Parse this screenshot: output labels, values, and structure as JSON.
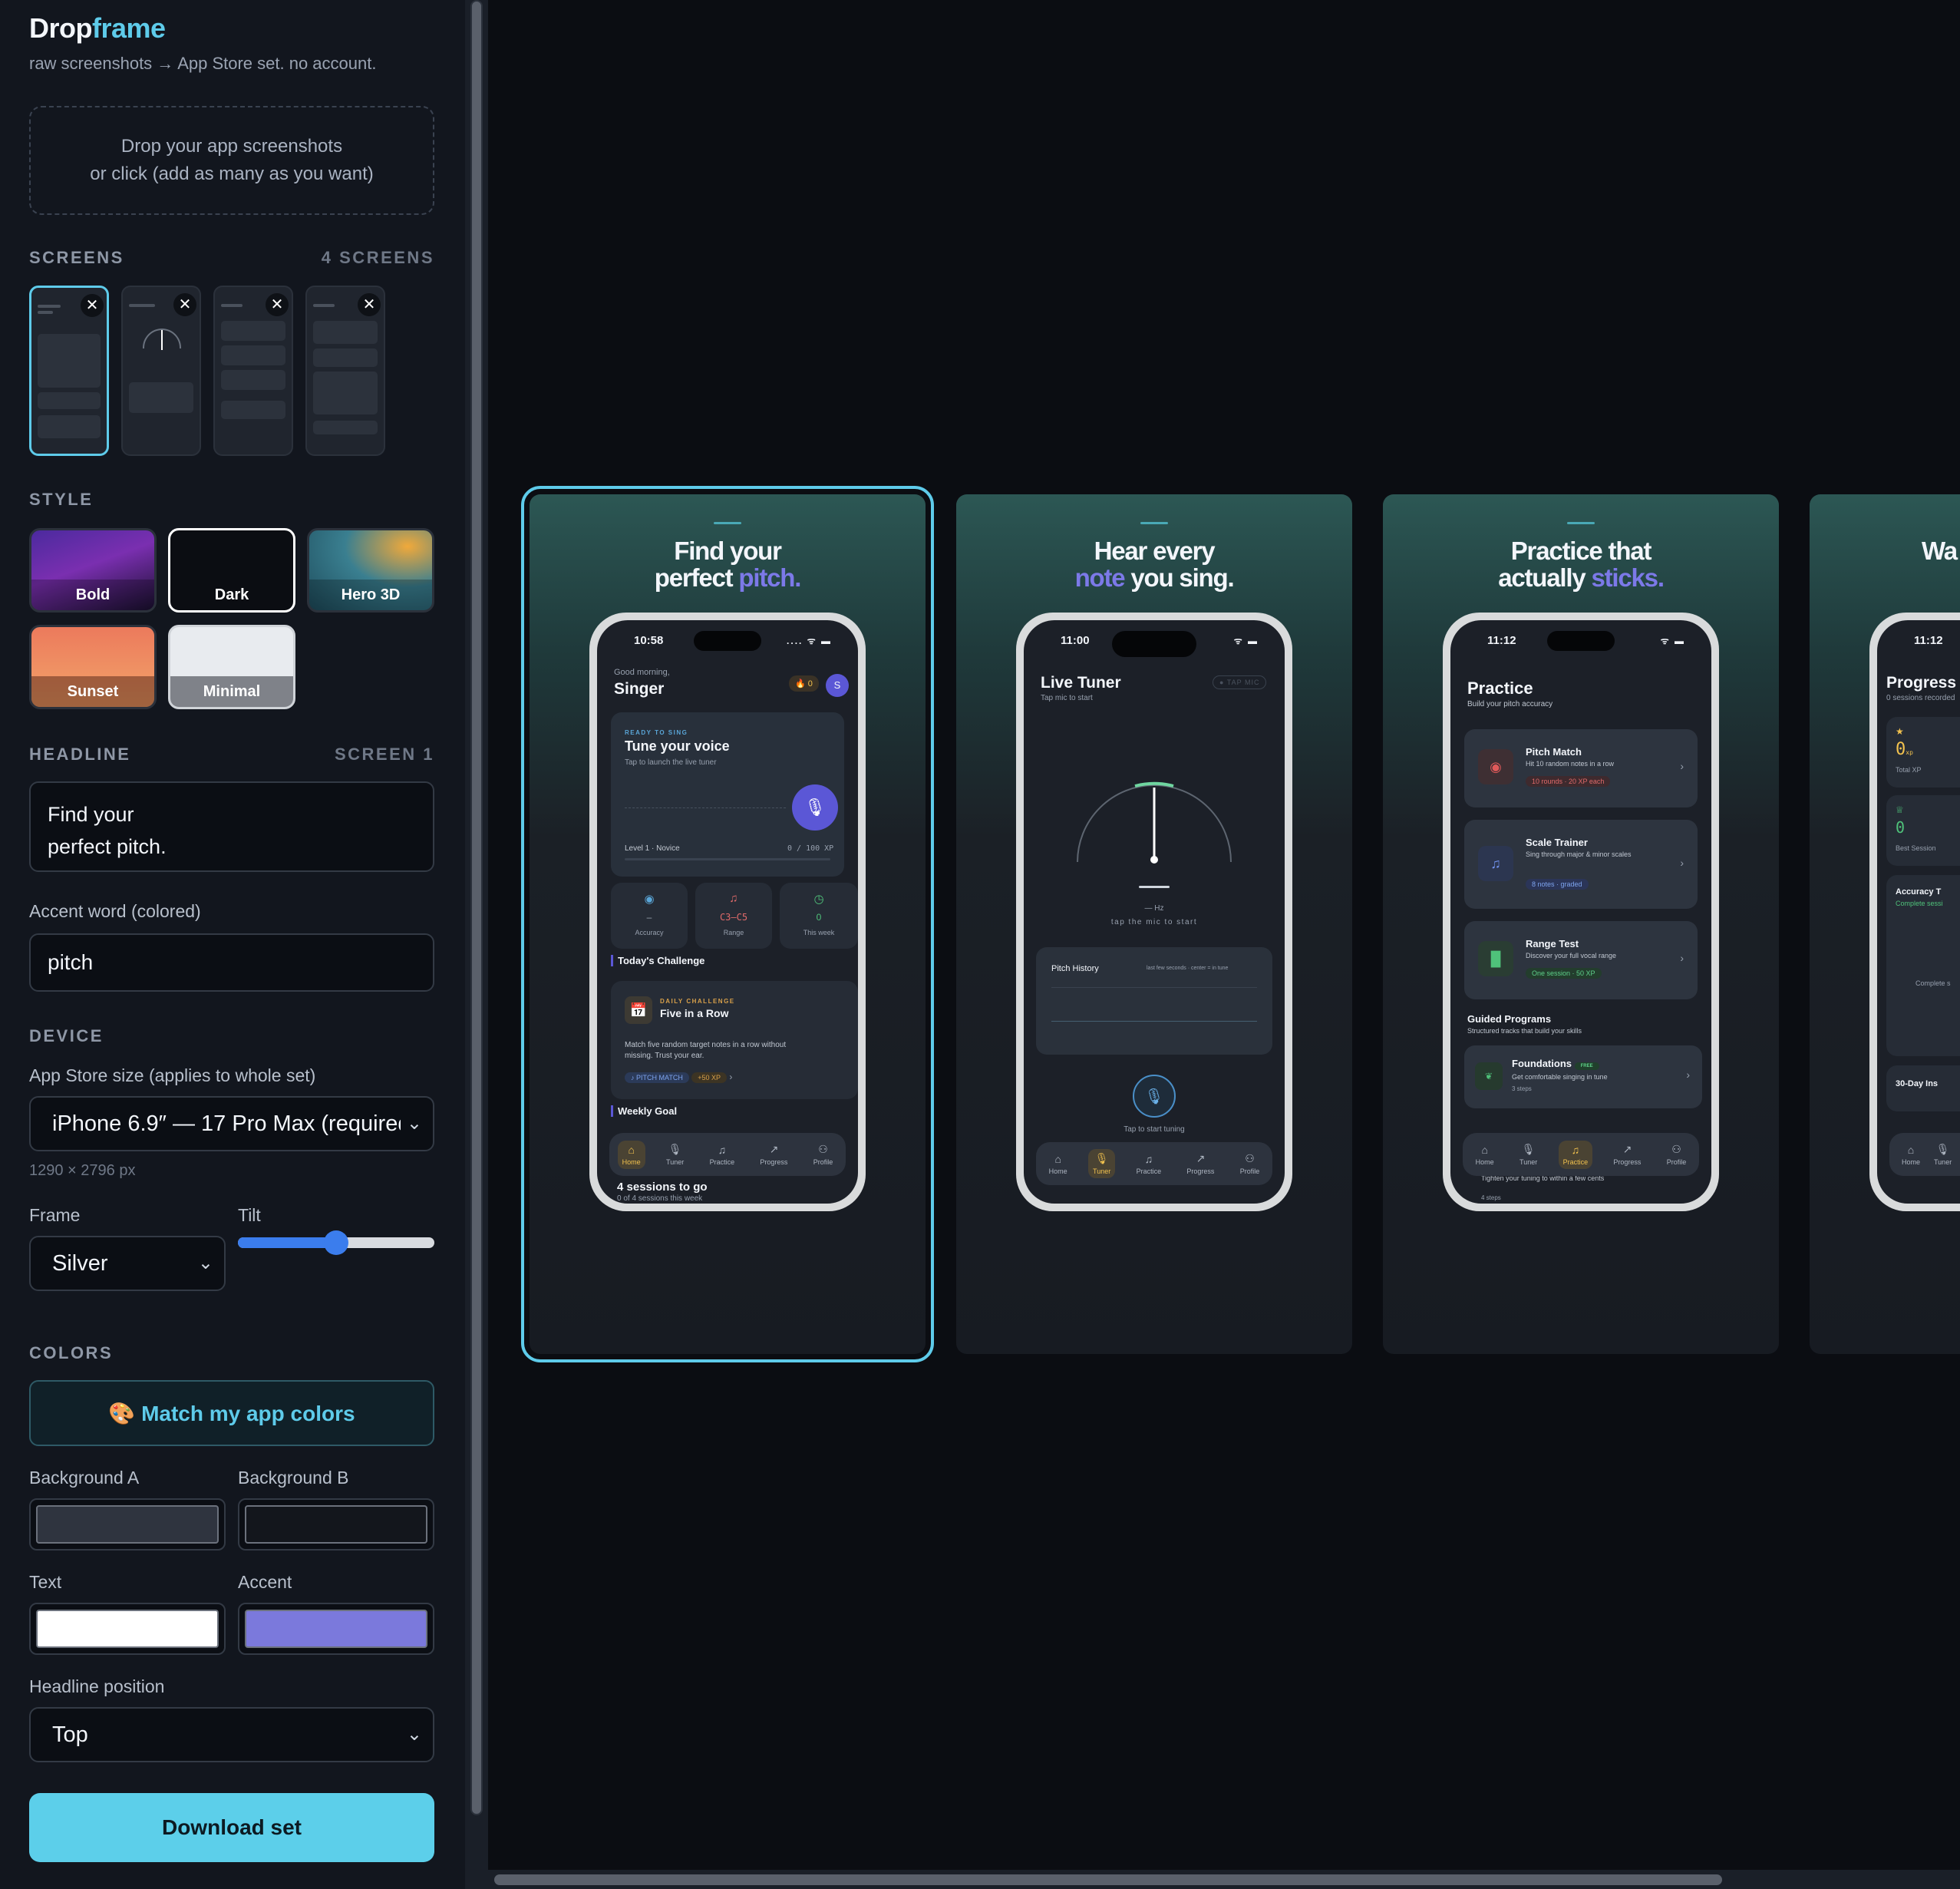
{
  "app": {
    "brand_a": "Drop",
    "brand_b": "frame",
    "tagline": "raw screenshots → App Store set. no account."
  },
  "dropzone": {
    "line1": "Drop your app screenshots",
    "line2": "or click (add as many as you want)"
  },
  "screens_section": {
    "title": "SCREENS",
    "count": "4 SCREENS",
    "remove": "✕"
  },
  "style_section": {
    "title": "STYLE",
    "options": [
      "Bold",
      "Dark",
      "Hero 3D",
      "Sunset",
      "Minimal"
    ],
    "selected": "Dark"
  },
  "headline_section": {
    "title": "HEADLINE",
    "screen": "SCREEN 1",
    "line1": "Find your",
    "line2": "perfect pitch."
  },
  "accent": {
    "label": "Accent word (colored)",
    "value": "pitch"
  },
  "device_section": {
    "title": "DEVICE",
    "size_label": "App Store size (applies to whole set)",
    "size_value": "iPhone 6.9″ — 17 Pro Max (required)",
    "dimensions": "1290 × 2796 px",
    "frame_label": "Frame",
    "frame_value": "Silver",
    "tilt_label": "Tilt",
    "tilt_value": 0.5
  },
  "colors_section": {
    "title": "COLORS",
    "match_button": "🎨 Match my app colors",
    "bg_a_label": "Background A",
    "bg_a": "#2f343f",
    "bg_b_label": "Background B",
    "bg_b": "#13161c",
    "text_label": "Text",
    "text": "#ffffff",
    "accent_label": "Accent",
    "accent": "#7b79dc"
  },
  "position": {
    "label": "Headline position",
    "value": "Top"
  },
  "download": "Download set",
  "preview": [
    {
      "h_line1": "Find your",
      "h_pre": "perfect ",
      "h_accent": "pitch.",
      "h_post": "",
      "time": "10:58",
      "greeting": "Good morning,",
      "name": "Singer",
      "streak": "🔥 0",
      "avatar": "S",
      "ready": "READY TO SING",
      "tune_title": "Tune your voice",
      "tune_sub": "Tap to launch the live tuner",
      "level": "Level 1 · Novice",
      "xp": "0 / 100 XP",
      "stats": [
        {
          "value": "–",
          "label": "Accuracy"
        },
        {
          "value": "C3–C5",
          "label": "Range"
        },
        {
          "value": "0",
          "label": "This week"
        }
      ],
      "challenge_h": "Today's Challenge",
      "daily": "DAILY CHALLENGE",
      "daily_title": "Five in a Row",
      "daily_desc1": "Match five random target notes in a row without",
      "daily_desc2": "missing. Trust your ear.",
      "daily_tag": "♪ PITCH MATCH",
      "daily_xp": "+50 XP",
      "weekly_h": "Weekly Goal",
      "weekly_val": "4 sessions to go",
      "weekly_sub": "0 of 4 sessions this week"
    },
    {
      "h_line1": "Hear every",
      "h_pre": "",
      "h_accent": "note",
      "h_post": " you sing.",
      "time": "11:00",
      "title": "Live Tuner",
      "sub": "Tap mic to start",
      "chip": "● TAP MIC",
      "hz": "— Hz",
      "tap": "tap the mic to start",
      "history": "Pitch History",
      "history_sub": "last few seconds · center = in tune",
      "tap_tuning": "Tap to start tuning"
    },
    {
      "h_line1": "Practice that",
      "h_pre": "actually ",
      "h_accent": "sticks.",
      "h_post": "",
      "time": "11:12",
      "title": "Practice",
      "sub": "Build your pitch accuracy",
      "cards": [
        {
          "title": "Pitch Match",
          "desc": "Hit 10 random notes in a row",
          "tag": "10 rounds · 20 XP each",
          "color": "#e05a5a"
        },
        {
          "title": "Scale Trainer",
          "desc": "Sing through major & minor scales",
          "tag": "8 notes · graded",
          "color": "#6f8fe8"
        },
        {
          "title": "Range Test",
          "desc": "Discover your full vocal range",
          "tag": "One session · 50 XP",
          "color": "#4fc27a"
        }
      ],
      "guided": "Guided Programs",
      "guided_sub": "Structured tracks that build your skills",
      "found": "Foundations",
      "free": "FREE",
      "found_desc": "Get comfortable singing in tune",
      "found_steps": "3 steps",
      "next_desc": "Tighten your tuning to within a few cents",
      "next_steps": "4 steps"
    },
    {
      "h_line1": "Wa",
      "time": "11:12",
      "title": "Progress",
      "sub": "0 sessions recorded",
      "total_xp": "0",
      "xp_unit": "xp",
      "total_lbl": "Total XP",
      "best": "0",
      "best_lbl": "Best Session",
      "acc_title": "Accuracy T",
      "acc_sub": "Complete sessi",
      "acc_empty": "Complete s",
      "insights": "30-Day Ins"
    }
  ],
  "tabs": [
    "Home",
    "Tuner",
    "Practice",
    "Progress",
    "Profile"
  ]
}
